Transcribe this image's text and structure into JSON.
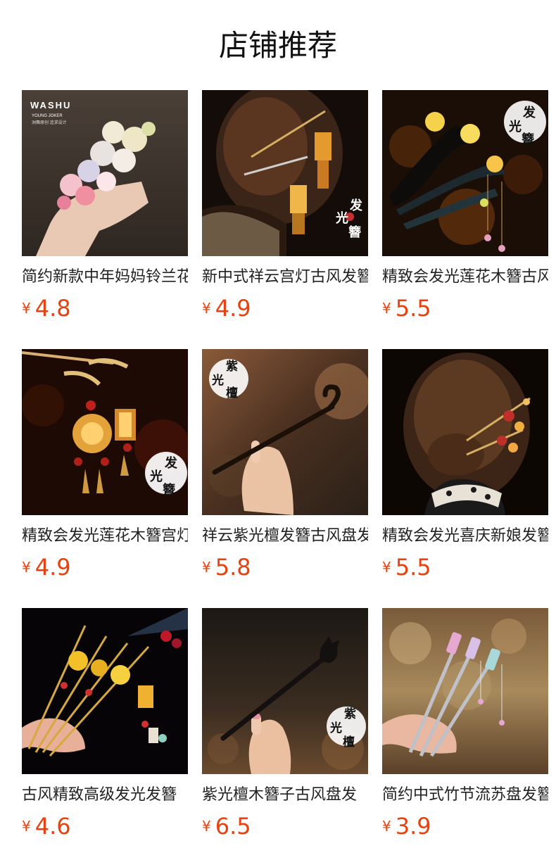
{
  "page": {
    "title": "店铺推荐"
  },
  "products": [
    {
      "name": "简约新款中年妈妈铃兰花发夹",
      "currency": "¥",
      "price": "4.8",
      "image": "flower-hairclip-photo",
      "brand": "WASHU",
      "brand_sub": "YOUNG JOKER",
      "brand_tag": "洲舞原创 追求设计"
    },
    {
      "name": "新中式祥云宫灯古风发簪",
      "currency": "¥",
      "price": "4.9",
      "image": "palace-lantern-hairpin-photo",
      "badge": [
        "发",
        "光",
        "簪"
      ]
    },
    {
      "name": "精致会发光莲花木簪古风",
      "currency": "¥",
      "price": "5.5",
      "image": "lotus-wood-hairpin-photo",
      "badge": [
        "发",
        "光",
        "簪"
      ]
    },
    {
      "name": "精致会发光莲花木簪宫灯",
      "currency": "¥",
      "price": "4.9",
      "image": "lantern-hairpin-photo",
      "badge": [
        "发",
        "光",
        "簪"
      ]
    },
    {
      "name": "祥云紫光檀发簪古风盘发",
      "currency": "¥",
      "price": "5.8",
      "image": "sandalwood-hairpin-photo",
      "badge": [
        "紫",
        "光",
        "檀"
      ]
    },
    {
      "name": "精致会发光喜庆新娘发簪",
      "currency": "¥",
      "price": "5.5",
      "image": "bride-hairpin-photo"
    },
    {
      "name": "古风精致高级发光发簪",
      "currency": "¥",
      "price": "4.6",
      "image": "glowing-hairpins-set-photo"
    },
    {
      "name": "紫光檀木簪子古风盘发",
      "currency": "¥",
      "price": "6.5",
      "image": "cat-head-hairpin-photo",
      "badge": [
        "紫",
        "光",
        "檀"
      ]
    },
    {
      "name": "简约中式竹节流苏盘发簪",
      "currency": "¥",
      "price": "3.9",
      "image": "bamboo-tassel-hairpin-photo"
    }
  ],
  "colors": {
    "price": "#e8410f",
    "text": "#222222",
    "title": "#111111"
  }
}
